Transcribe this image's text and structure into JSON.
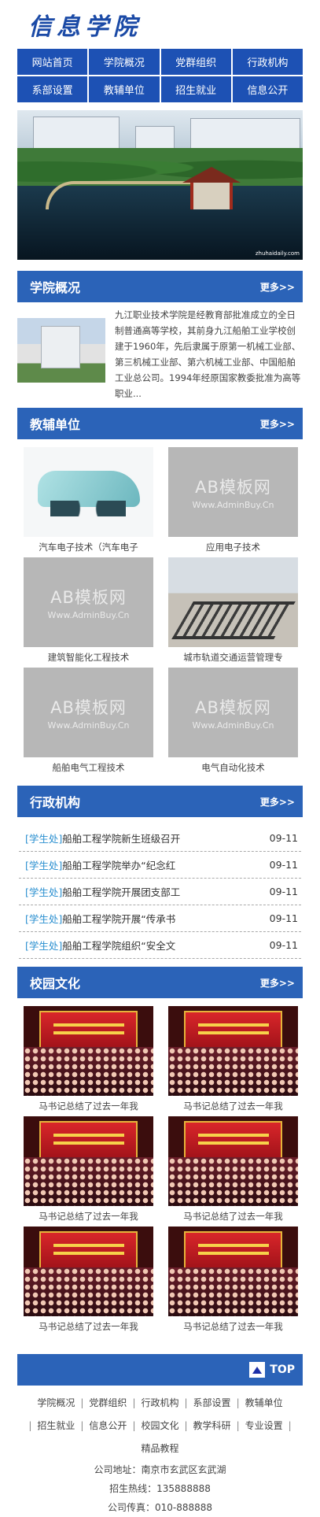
{
  "header": {
    "logo_text": "信息学院"
  },
  "nav": [
    "网站首页",
    "学院概况",
    "党群组织",
    "行政机构",
    "系部设置",
    "教辅单位",
    "招生就业",
    "信息公开"
  ],
  "banner": {
    "watermark": "zhuhaidaily.com"
  },
  "about": {
    "title": "学院概况",
    "more": "更多>>",
    "text": "九江职业技术学院是经教育部批准成立的全日制普通高等学校，其前身九江船舶工业学校创建于1960年，先后隶属于原第一机械工业部、第三机械工业部、第六机械工业部、中国船舶工业总公司。1994年经原国家教委批准为高等职业..."
  },
  "units": {
    "title": "教辅单位",
    "more": "更多>>",
    "watermark_a": "AB模板网",
    "watermark_b": "Www.AdminBuy.Cn",
    "items": [
      {
        "caption": "汽车电子技术（汽车电子",
        "image": "car-diagram"
      },
      {
        "caption": "应用电子技术",
        "image": "placeholder"
      },
      {
        "caption": "建筑智能化工程技术",
        "image": "placeholder"
      },
      {
        "caption": "城市轨道交通运营管理专",
        "image": "rail-track"
      },
      {
        "caption": "船舶电气工程技术",
        "image": "placeholder"
      },
      {
        "caption": "电气自动化技术",
        "image": "placeholder"
      }
    ]
  },
  "admin": {
    "title": "行政机构",
    "more": "更多>>",
    "items": [
      {
        "cat": "[学生处]",
        "title": "船舶工程学院新生班级召开",
        "date": "09-11"
      },
      {
        "cat": "[学生处]",
        "title": "船舶工程学院举办“纪念红",
        "date": "09-11"
      },
      {
        "cat": "[学生处]",
        "title": "船舶工程学院开展团支部工",
        "date": "09-11"
      },
      {
        "cat": "[学生处]",
        "title": "船舶工程学院开展“传承书",
        "date": "09-11"
      },
      {
        "cat": "[学生处]",
        "title": "船舶工程学院组织“安全文",
        "date": "09-11"
      }
    ]
  },
  "culture": {
    "title": "校园文化",
    "more": "更多>>",
    "items": [
      {
        "caption": "马书记总结了过去一年我"
      },
      {
        "caption": "马书记总结了过去一年我"
      },
      {
        "caption": "马书记总结了过去一年我"
      },
      {
        "caption": "马书记总结了过去一年我"
      },
      {
        "caption": "马书记总结了过去一年我"
      },
      {
        "caption": "马书记总结了过去一年我"
      }
    ]
  },
  "footer": {
    "top_label": "TOP",
    "links": [
      "学院概况",
      "党群组织",
      "行政机构",
      "系部设置",
      "教辅单位",
      "招生就业",
      "信息公开",
      "校园文化",
      "教学科研",
      "专业设置",
      "精品教程"
    ],
    "address": "公司地址：南京市玄武区玄武湖",
    "hotline": "招生热线：135888888",
    "fax": "公司传真：010-888888"
  },
  "colors": {
    "brand_blue": "#1d51b4",
    "section_blue": "#2b63b8",
    "category_blue": "#2a8fd0"
  }
}
